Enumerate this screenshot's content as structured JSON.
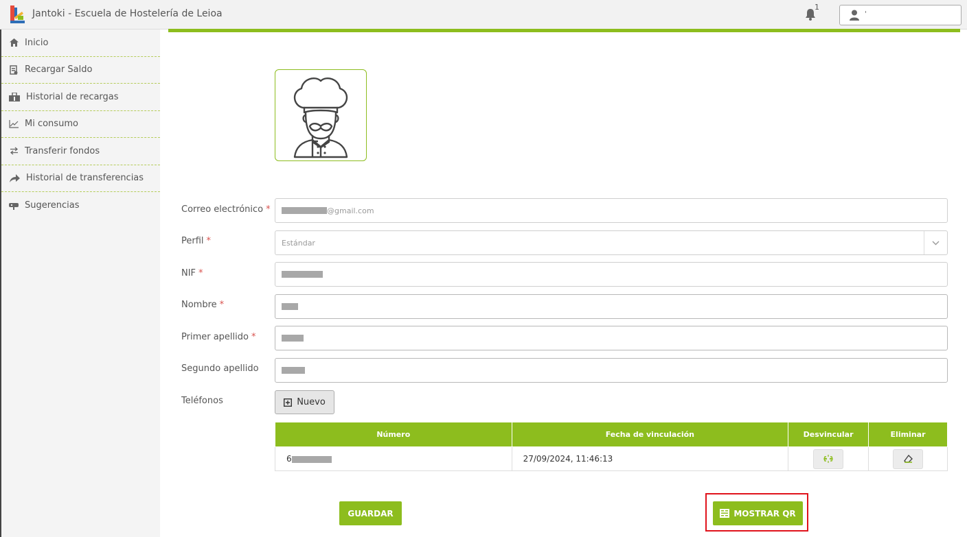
{
  "app": {
    "title": "Jantoki - Escuela de Hostelería de Leioa",
    "notification_count": "1",
    "user_name": "'"
  },
  "sidebar": {
    "items": [
      {
        "label": "Inicio",
        "icon": "home-icon"
      },
      {
        "label": "Recargar Saldo",
        "icon": "reload-card-icon"
      },
      {
        "label": "Historial de recargas",
        "icon": "history-bag-icon"
      },
      {
        "label": "Mi consumo",
        "icon": "chart-line-icon"
      },
      {
        "label": "Transferir fondos",
        "icon": "transfer-icon"
      },
      {
        "label": "Historial de transferencias",
        "icon": "share-arrow-icon"
      },
      {
        "label": "Sugerencias",
        "icon": "mailbox-icon"
      }
    ]
  },
  "form": {
    "email_label": "Correo electrónico",
    "email_value": "@gmail.com",
    "perfil_label": "Perfil",
    "perfil_value": "Estándar",
    "nif_label": "NIF",
    "nombre_label": "Nombre",
    "apellido1_label": "Primer apellido",
    "apellido2_label": "Segundo apellido",
    "telefonos_label": "Teléfonos",
    "required_mark": "*",
    "nuevo_label": "Nuevo"
  },
  "phones_table": {
    "headers": [
      "Número",
      "Fecha de vinculación",
      "Desvincular",
      "Eliminar"
    ],
    "rows": [
      {
        "numero_prefix": "6",
        "fecha": "27/09/2024, 11:46:13"
      }
    ]
  },
  "actions": {
    "guardar_label": "GUARDAR",
    "qr_label": "MOSTRAR QR"
  },
  "colors": {
    "accent": "#8dbd1e",
    "highlight": "#e0121b"
  }
}
